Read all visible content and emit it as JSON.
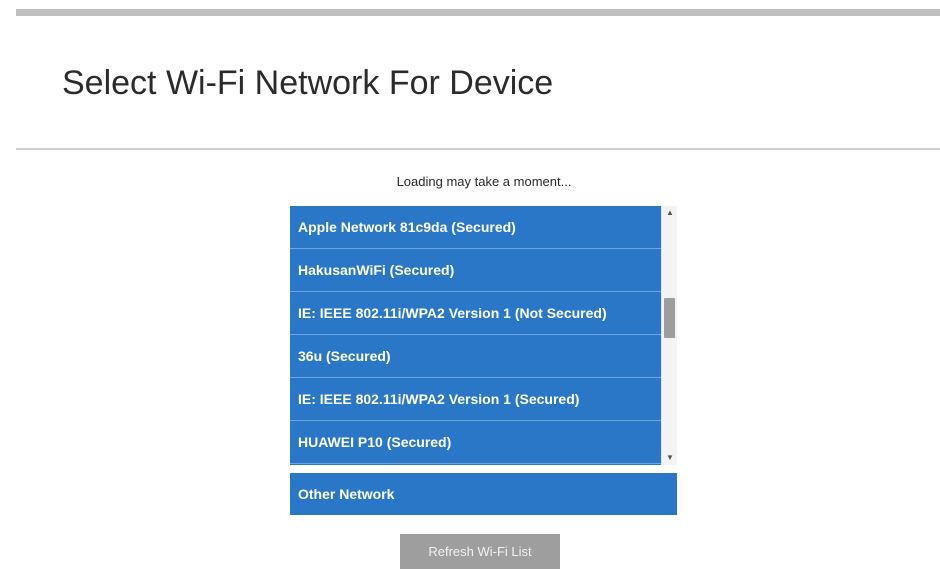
{
  "header": {
    "title": "Select Wi-Fi Network For Device"
  },
  "status": {
    "loading_text": "Loading may take a moment..."
  },
  "networks": [
    {
      "label": "Apple Network 81c9da  (Secured)"
    },
    {
      "label": "HakusanWiFi  (Secured)"
    },
    {
      "label": "IE: IEEE 802.11i/WPA2 Version 1  (Not Secured)"
    },
    {
      "label": "36u  (Secured)"
    },
    {
      "label": "IE: IEEE 802.11i/WPA2 Version 1  (Secured)"
    },
    {
      "label": "HUAWEI P10  (Secured)"
    }
  ],
  "other_network": {
    "label": "Other Network"
  },
  "refresh_button": {
    "label": "Refresh Wi-Fi List"
  },
  "colors": {
    "list_blue": "#2a77c8",
    "button_gray": "#9e9e9e"
  },
  "icons": {
    "scroll_up": "scroll-up-arrow-icon",
    "scroll_down": "scroll-down-arrow-icon"
  }
}
